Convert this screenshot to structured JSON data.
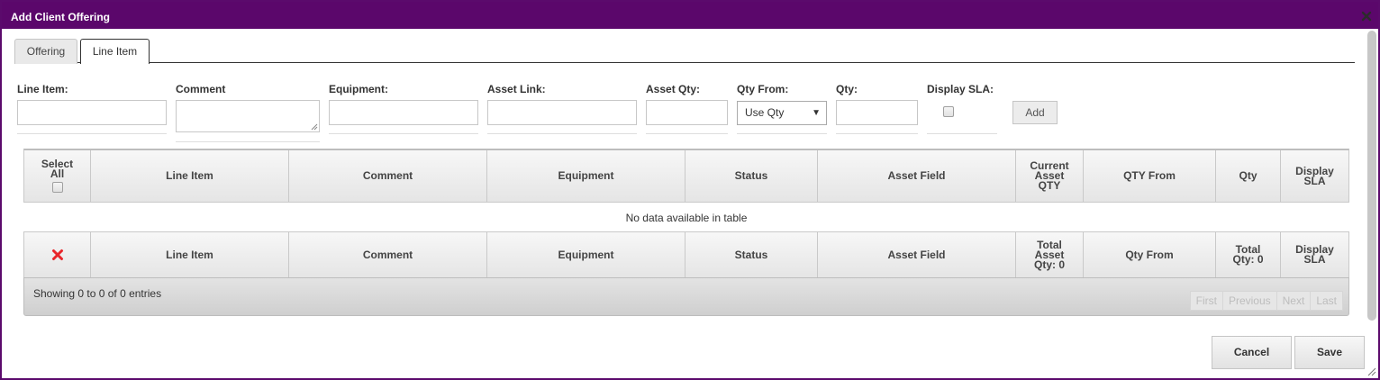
{
  "window": {
    "title": "Add Client Offering"
  },
  "tabs": [
    {
      "label": "Offering"
    },
    {
      "label": "Line Item"
    }
  ],
  "form": {
    "line_item": {
      "label": "Line Item:",
      "value": ""
    },
    "comment": {
      "label": "Comment",
      "value": ""
    },
    "equipment": {
      "label": "Equipment:",
      "value": ""
    },
    "asset_link": {
      "label": "Asset Link:",
      "value": ""
    },
    "asset_qty": {
      "label": "Asset Qty:",
      "value": ""
    },
    "qty_from": {
      "label": "Qty From:",
      "selected": "Use Qty"
    },
    "qty": {
      "label": "Qty:",
      "value": ""
    },
    "display_sla": {
      "label": "Display SLA:",
      "checked": false
    },
    "add_label": "Add"
  },
  "table": {
    "header": {
      "select_all": "Select All",
      "line_item": "Line Item",
      "comment": "Comment",
      "equipment": "Equipment",
      "status": "Status",
      "asset_field": "Asset Field",
      "current_asset_qty": "Current Asset QTY",
      "qty_from": "QTY From",
      "qty": "Qty",
      "display_sla": "Display SLA"
    },
    "empty_message": "No data available in table",
    "footer_row": {
      "line_item": "Line Item",
      "comment": "Comment",
      "equipment": "Equipment",
      "status": "Status",
      "asset_field": "Asset Field",
      "total_asset_qty": "Total Asset Qty: 0",
      "qty_from": "Qty From",
      "total_qty": "Total Qty: 0",
      "display_sla": "Display SLA"
    },
    "info": "Showing 0 to 0 of 0 entries",
    "pager": {
      "first": "First",
      "previous": "Previous",
      "next": "Next",
      "last": "Last"
    }
  },
  "buttons": {
    "cancel": "Cancel",
    "save": "Save"
  },
  "colors": {
    "titlebar": "#5b076b",
    "delete_icon": "#e8262b"
  }
}
